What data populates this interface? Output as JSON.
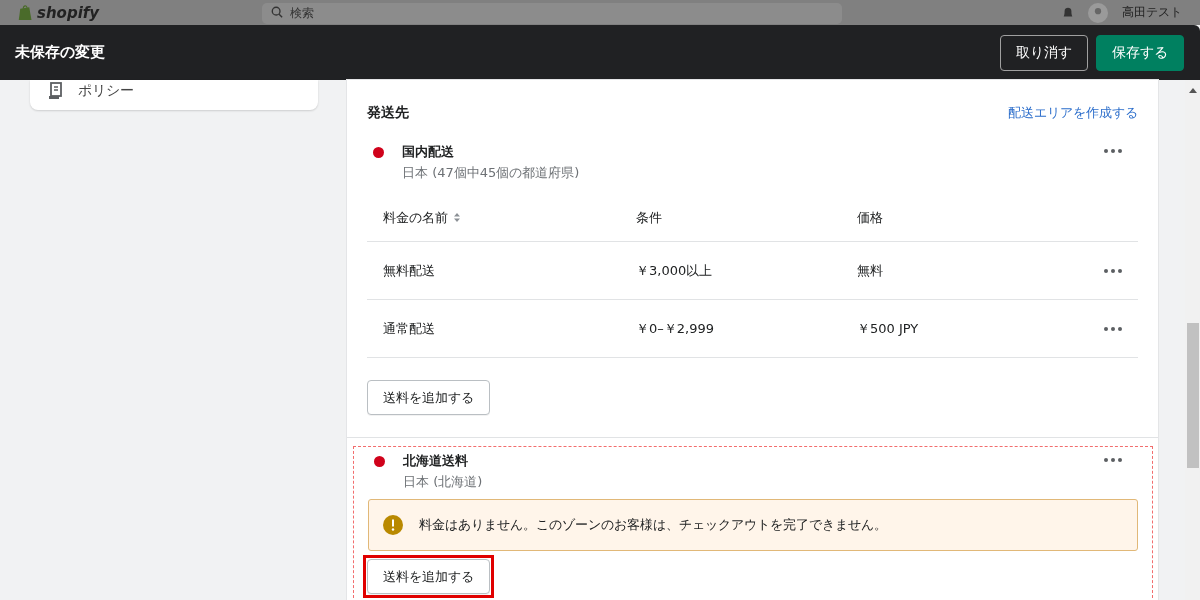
{
  "top_bar": {
    "logo": "shopify",
    "search": {
      "placeholder": "検索"
    },
    "user": "高田テスト"
  },
  "save_bar": {
    "title": "未保存の変更",
    "buttons": [
      {
        "label": "取り消す",
        "kind": "secondary"
      },
      {
        "label": "保存する",
        "kind": "primary"
      }
    ]
  },
  "sidebar": {
    "items": [
      {
        "label": "ポリシー"
      }
    ]
  },
  "shipping": {
    "title": "発送先",
    "action": "配送エリアを作成する",
    "zones": [
      {
        "name": "国内配送",
        "region": "日本 (47個中45個の都道府県)",
        "color": "#d0021b",
        "highlighted": false,
        "columns": [
          {
            "label": "料金の名前",
            "sortable": true
          },
          {
            "label": "条件",
            "sortable": false
          },
          {
            "label": "価格",
            "sortable": false
          }
        ],
        "rates": [
          {
            "name": "無料配送",
            "condition": "￥3,000以上",
            "price": "無料"
          },
          {
            "name": "通常配送",
            "condition": "￥0–￥2,999",
            "price": "￥500 JPY"
          }
        ],
        "add_button": {
          "label": "送料を追加する",
          "highlighted": false
        }
      },
      {
        "name": "北海道送料",
        "region": "日本 (北海道)",
        "color": "#d0021b",
        "highlighted": true,
        "warning": "料金はありません。このゾーンのお客様は、チェックアウトを完了できません。",
        "add_button": {
          "label": "送料を追加する",
          "highlighted": true
        }
      }
    ]
  }
}
